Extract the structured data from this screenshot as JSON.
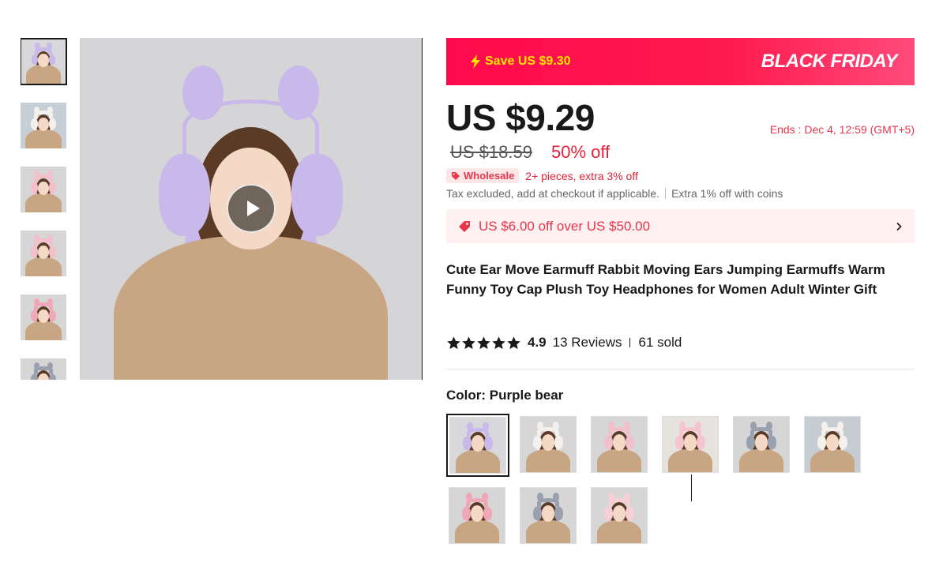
{
  "gallery": {
    "thumbnails": [
      {
        "name": "thumb-1",
        "muff": "#c9b8ea",
        "bg": "#d8d8dc"
      },
      {
        "name": "thumb-2",
        "muff": "#f4f1ec",
        "bg": "#c6cfd6"
      },
      {
        "name": "thumb-3",
        "muff": "#f2bfca",
        "bg": "#d6d6d6"
      },
      {
        "name": "thumb-4",
        "muff": "#f2bfca",
        "bg": "#d6d6d6"
      },
      {
        "name": "thumb-5",
        "muff": "#f0a8b6",
        "bg": "#d6d6d6"
      },
      {
        "name": "thumb-6",
        "muff": "#9aa0ae",
        "bg": "#d6d6d6"
      }
    ],
    "main_image_color": "#c9b8ea",
    "play_icon": "play-icon"
  },
  "promo": {
    "save_text": "Save US $9.30",
    "event_text": "BLACK FRIDAY",
    "bolt_icon": "lightning-icon"
  },
  "price": {
    "current": "US $9.29",
    "original": "US $18.59",
    "discount": "50% off",
    "ends": "Ends :  Dec 4, 12:59 (GMT+5)"
  },
  "wholesale": {
    "badge": "Wholesale",
    "text": "2+ pieces, extra 3% off"
  },
  "tax": {
    "text": "Tax excluded, add at checkout if applicable.",
    "coins": "Extra 1% off with coins"
  },
  "coupon": {
    "text": "US $6.00 off over US $50.00"
  },
  "product": {
    "title": "Cute Ear Move Earmuff Rabbit Moving Ears Jumping Earmuffs Warm Funny Toy Cap Plush Toy Headphones for Women Adult Winter Gift",
    "rating": "4.9",
    "stars": 5,
    "reviews": "13 Reviews",
    "sold": "61 sold"
  },
  "color": {
    "label": "Color: Purple bear",
    "options": [
      {
        "muff": "#c9b8ea",
        "bg": "#d8d8dc"
      },
      {
        "muff": "#f4f1ec",
        "bg": "#d6d6d6"
      },
      {
        "muff": "#f2bfca",
        "bg": "#d6d6d6"
      },
      {
        "muff": "#f5c4cf",
        "bg": "#e6e3df"
      },
      {
        "muff": "#9aa0ae",
        "bg": "#d6d6d6"
      },
      {
        "muff": "#f4f1ec",
        "bg": "#c7ccd2"
      },
      {
        "muff": "#f0a8b6",
        "bg": "#d6d6d6"
      },
      {
        "muff": "#9aa0ae",
        "bg": "#d6d6d6"
      },
      {
        "muff": "#f7d0d6",
        "bg": "#d6d6d6"
      }
    ]
  },
  "colors": {
    "accent_red": "#e32139",
    "promo_pink": "#ff0a4e",
    "save_yellow": "#ffe400"
  }
}
